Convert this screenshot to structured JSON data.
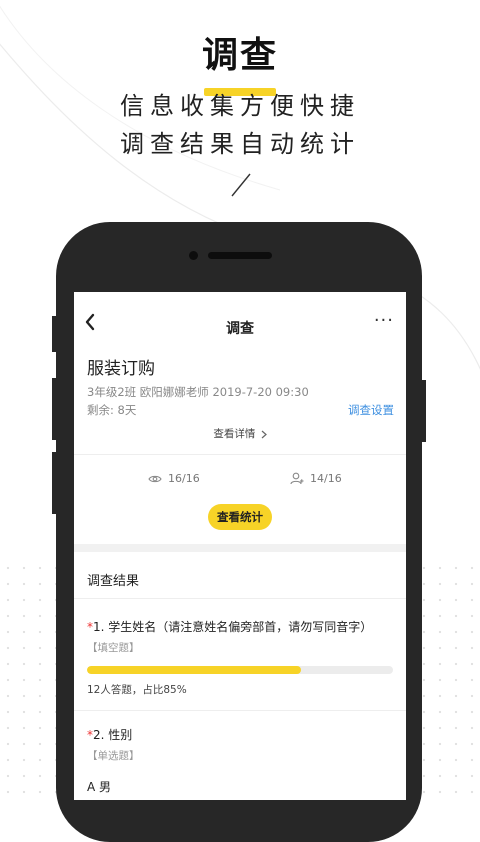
{
  "hero": {
    "title": "调查",
    "line1": "信息收集方便快捷",
    "line2": "调查结果自动统计"
  },
  "colors": {
    "accent": "#f7d327",
    "link": "#3d8fe0",
    "required": "#ee3333",
    "phone": "#272727"
  },
  "nav": {
    "back_icon": "chevron-left-icon",
    "title": "调查",
    "more": "···"
  },
  "survey": {
    "title": "服装订购",
    "meta": "3年级2班  欧阳娜娜老师  2019-7-20 09:30",
    "remaining": "剩余: 8天",
    "settings_link": "调查设置",
    "details_link": "查看详情",
    "views": "16/16",
    "answers": "14/16",
    "stats_button": "查看统计"
  },
  "results": {
    "title": "调查结果",
    "questions": [
      {
        "required_mark": "*",
        "label": "1. 学生姓名（请注意姓名偏旁部首，请勿写同音字）",
        "type": "【填空题】",
        "progress": 0.7,
        "summary": "12人答题，占比85%"
      },
      {
        "required_mark": "*",
        "label": "2. 性别",
        "type": "【单选题】",
        "option_a": "A  男"
      }
    ]
  }
}
